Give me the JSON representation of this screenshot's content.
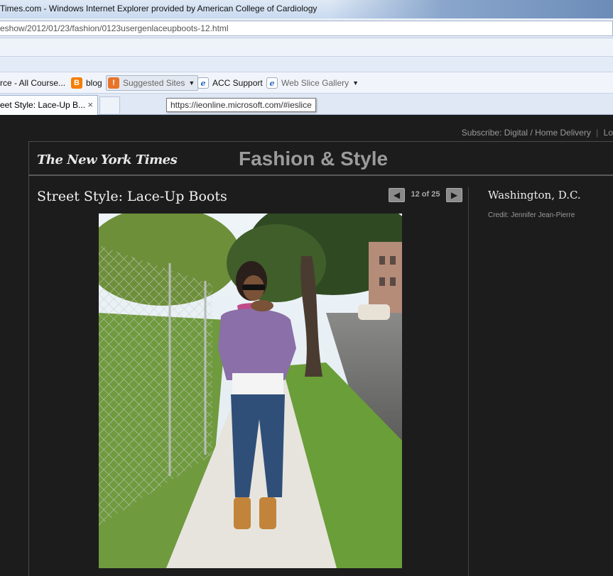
{
  "browser": {
    "window_title": "Times.com - Windows Internet Explorer provided by American College of Cardiology",
    "url": "eshow/2012/01/23/fashion/0123usergenlaceupboots-12.html",
    "favorites": {
      "item1": "rce - All Course...",
      "item2": "blog",
      "item3": "Suggested Sites",
      "item4": "ACC Support",
      "item5": "Web Slice Gallery"
    },
    "tab_label": "eet Style: Lace-Up B...",
    "tab_close": "×",
    "tooltip": "https://ieonline.microsoft.com/#ieslice"
  },
  "page": {
    "subscribe_label": "Subscribe:",
    "digital_label": "Digital",
    "delivery_label": "Home Delivery",
    "login_label": "Lo",
    "logo_text": "The New York Times",
    "section_title": "Fashion & Style",
    "slide_title": "Street Style: Lace-Up Boots",
    "counter": "12 of 25",
    "prev_glyph": "◀",
    "next_glyph": "▶",
    "caption_title": "Washington, D.C.",
    "credit": "Credit: Jennifer Jean-Pierre"
  },
  "colors": {
    "page_background": "#1c1c1c",
    "section_title": "#9b9b9b",
    "nav_button": "#8a8a8a"
  }
}
